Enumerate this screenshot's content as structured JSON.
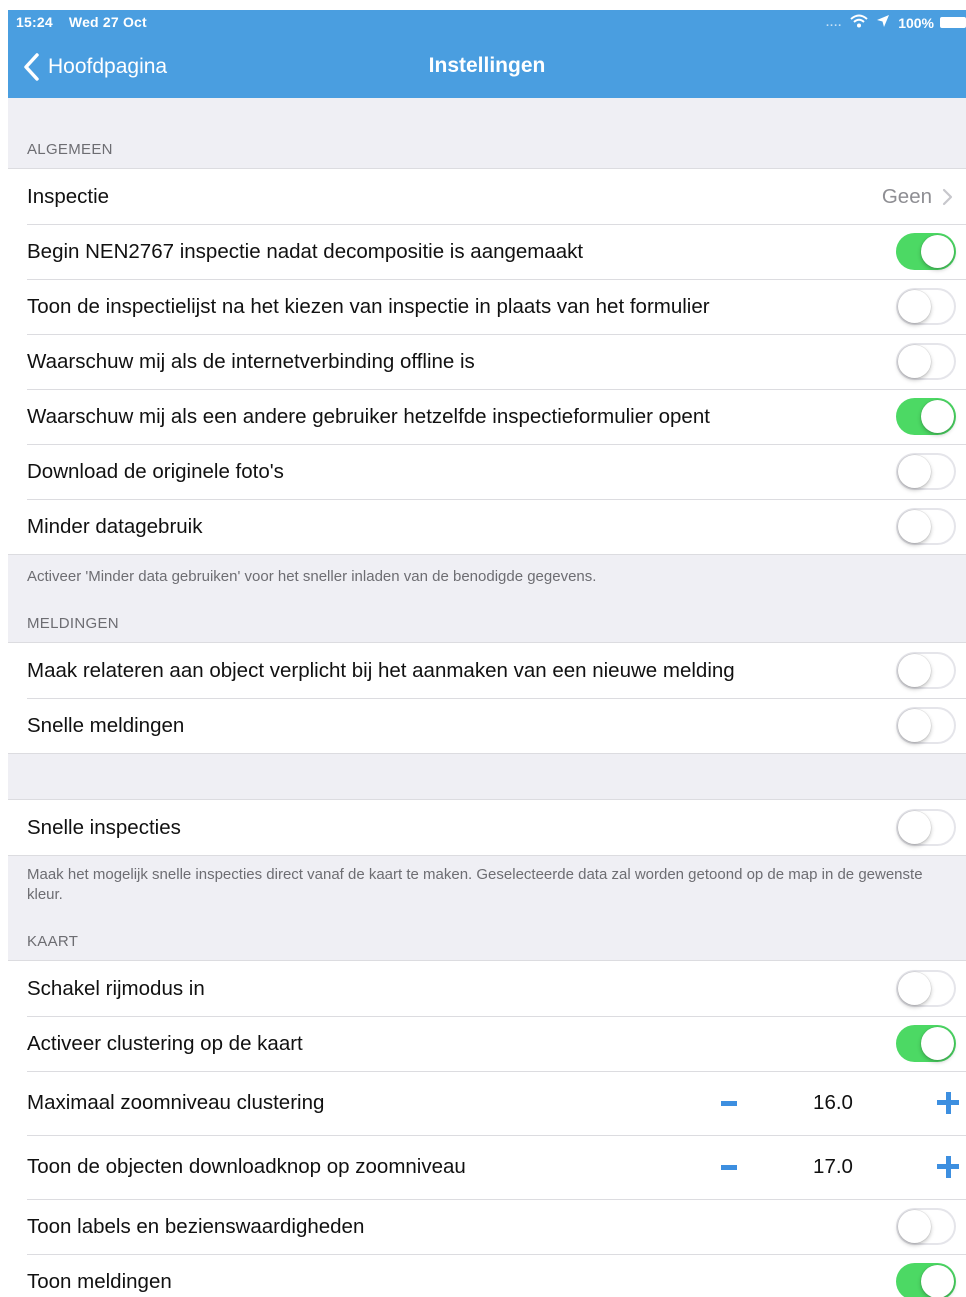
{
  "status_bar": {
    "time": "15:24",
    "date": "Wed 27 Oct",
    "signal": "....",
    "battery": "100%",
    "icons": [
      "wifi-icon",
      "location-icon",
      "battery-icon"
    ]
  },
  "nav": {
    "back_label": "Hoofdpagina",
    "title": "Instellingen"
  },
  "sections": {
    "algemeen": {
      "header": "ALGEMEEN",
      "inspectie": {
        "label": "Inspectie",
        "value": "Geen"
      },
      "begin_nen": {
        "label": "Begin NEN2767 inspectie nadat decompositie is aangemaakt",
        "on": true
      },
      "toon_inspectielijst": {
        "label": "Toon de inspectielijst na het kiezen van inspectie in plaats van het formulier",
        "on": false
      },
      "waarschuw_offline": {
        "label": "Waarschuw mij als de internetverbinding offline is",
        "on": false
      },
      "waarschuw_gebruiker": {
        "label": "Waarschuw mij als een andere gebruiker hetzelfde inspectieformulier opent",
        "on": true
      },
      "download_fotos": {
        "label": "Download de originele foto's",
        "on": false
      },
      "minder_data": {
        "label": "Minder datagebruik",
        "on": false
      },
      "footer": "Activeer 'Minder data gebruiken' voor het sneller inladen van de benodigde gegevens."
    },
    "meldingen": {
      "header": "MELDINGEN",
      "relateren": {
        "label": "Maak relateren aan object verplicht bij het aanmaken van een nieuwe melding",
        "on": false
      },
      "snelle_meldingen": {
        "label": "Snelle meldingen",
        "on": false
      }
    },
    "inspecties": {
      "snelle_inspecties": {
        "label": "Snelle inspecties",
        "on": false
      },
      "footer": "Maak het mogelijk snelle inspecties direct vanaf de kaart te maken. Geselecteerde data zal worden getoond op de map in de gewenste kleur."
    },
    "kaart": {
      "header": "KAART",
      "rijmodus": {
        "label": "Schakel rijmodus in",
        "on": false
      },
      "clustering": {
        "label": "Activeer clustering op de kaart",
        "on": true
      },
      "max_zoom": {
        "label": "Maximaal zoomniveau clustering",
        "value": "16.0"
      },
      "download_knop": {
        "label": "Toon de objecten downloadknop op zoomniveau",
        "value": "17.0"
      },
      "labels": {
        "label": "Toon labels en bezienswaardigheden",
        "on": false
      },
      "toon_meldingen": {
        "label": "Toon meldingen",
        "on": true
      }
    }
  },
  "colors": {
    "nav_bar": "#4a9ee0",
    "toggle_on": "#4cd964",
    "stepper": "#3d8fe0",
    "background": "#efeff4"
  }
}
